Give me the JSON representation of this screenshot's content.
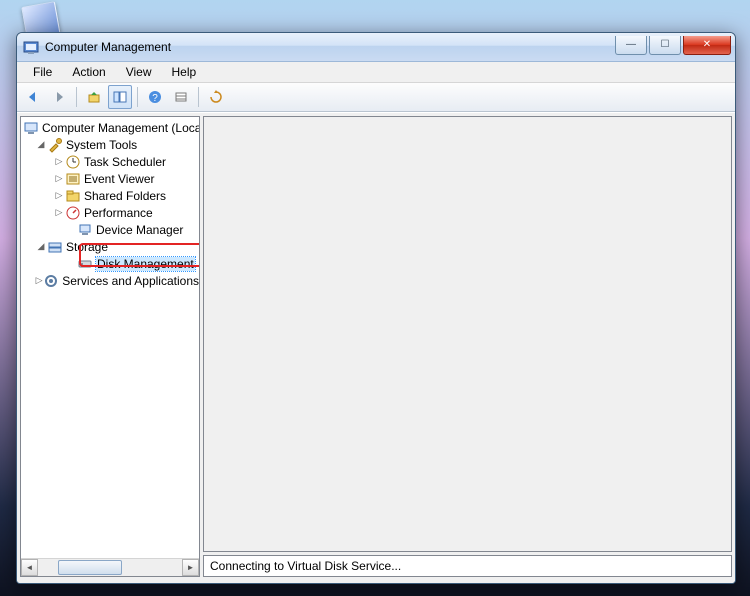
{
  "desktop": {
    "shortcut_name": "desktop-shortcut"
  },
  "window": {
    "title": "Computer Management",
    "menu": {
      "file": "File",
      "action": "Action",
      "view": "View",
      "help": "Help"
    },
    "toolbar_icons": {
      "back": "back-arrow-icon",
      "forward": "forward-arrow-icon",
      "up": "up-folder-icon",
      "show_hide": "show-hide-tree-icon",
      "help": "help-icon",
      "options1": "options-icon",
      "options2": "refresh-icon"
    }
  },
  "tree": {
    "root": "Computer Management (Local",
    "system_tools": {
      "label": "System Tools",
      "children": {
        "task_scheduler": "Task Scheduler",
        "event_viewer": "Event Viewer",
        "shared_folders": "Shared Folders",
        "performance": "Performance",
        "device_manager": "Device Manager"
      }
    },
    "storage": {
      "label": "Storage",
      "children": {
        "disk_management": "Disk Management"
      }
    },
    "services_apps": {
      "label": "Services and Applications"
    }
  },
  "status": {
    "text": "Connecting to Virtual Disk Service..."
  }
}
